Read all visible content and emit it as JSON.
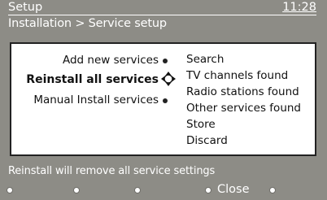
{
  "header": {
    "title": "Setup",
    "clock": "11:28",
    "breadcrumb": "Installation > Service setup"
  },
  "menu": {
    "items": [
      {
        "label": "Add new services",
        "active": false
      },
      {
        "label": "Reinstall all services",
        "active": true
      },
      {
        "label": "Manual Install services",
        "active": false
      }
    ]
  },
  "options": [
    "Search",
    "TV channels found",
    "Radio stations found",
    "Other services found",
    "Store",
    "Discard"
  ],
  "footer": {
    "message": "Reinstall will remove all service settings",
    "close_label": "Close"
  },
  "colors": {
    "background": "#8d8c86",
    "panel": "#ffffff",
    "text": "#111111"
  }
}
